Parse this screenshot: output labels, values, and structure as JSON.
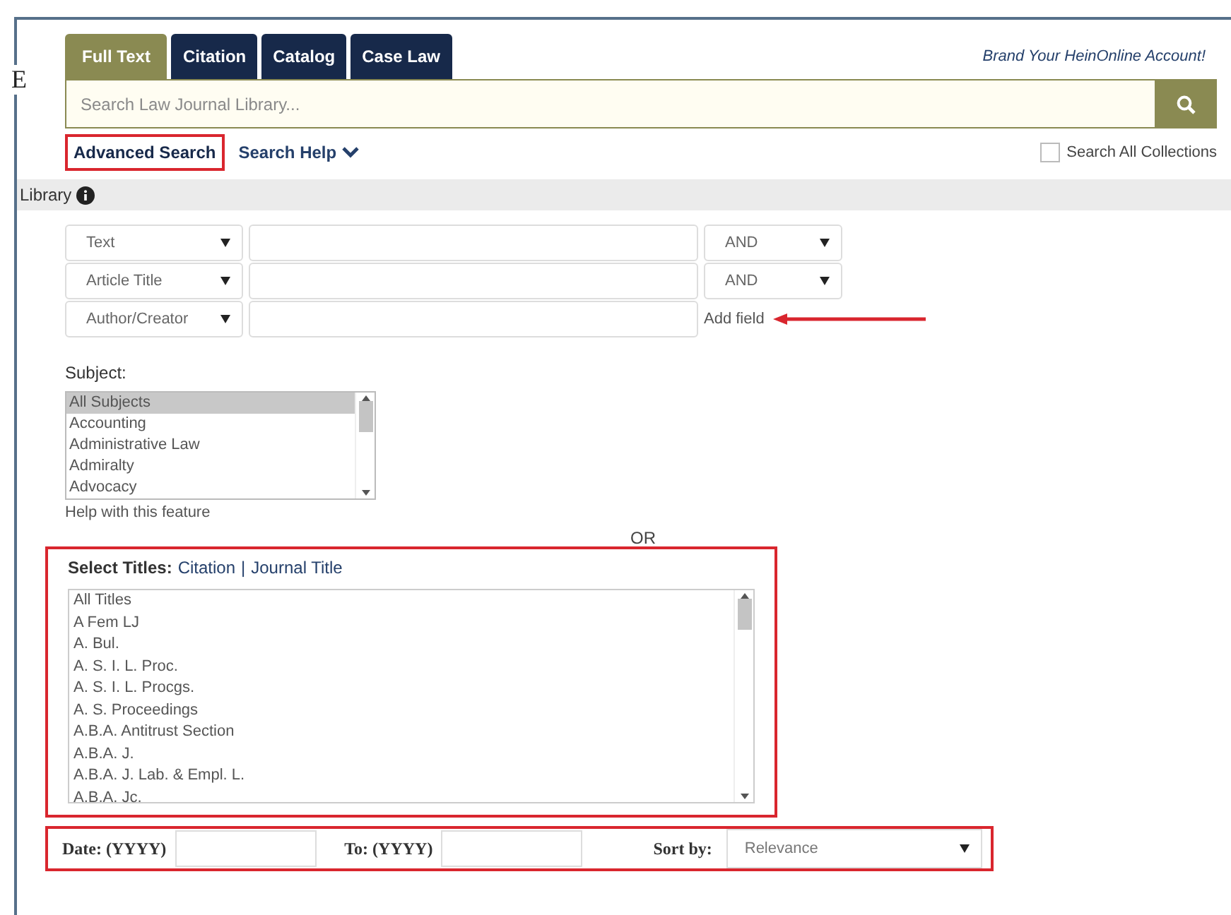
{
  "stray_glyph": "E",
  "tabs": [
    {
      "label": "Full Text",
      "selected": true
    },
    {
      "label": "Citation",
      "selected": false
    },
    {
      "label": "Catalog",
      "selected": false
    },
    {
      "label": "Case Law",
      "selected": false
    }
  ],
  "account_link": "Brand Your HeinOnline Account!",
  "search": {
    "placeholder": "Search Law Journal Library..."
  },
  "advanced_search": {
    "label": "Advanced Search",
    "highlighted": true
  },
  "search_help": "Search Help",
  "search_all": {
    "label": "Search All Collections",
    "checked": false
  },
  "library_label": "Library",
  "field_rows": [
    {
      "field": "Text",
      "value": "",
      "operator": "AND"
    },
    {
      "field": "Article Title",
      "value": "",
      "operator": "AND"
    },
    {
      "field": "Author/Creator",
      "value": ""
    }
  ],
  "add_field": "Add field",
  "subject": {
    "label": "Subject:",
    "items": [
      {
        "label": "All Subjects",
        "selected": true
      },
      {
        "label": "Accounting",
        "selected": false
      },
      {
        "label": "Administrative Law",
        "selected": false
      },
      {
        "label": "Admiralty",
        "selected": false
      },
      {
        "label": "Advocacy",
        "selected": false
      }
    ],
    "help": "Help with this feature"
  },
  "or_label": "OR",
  "titles": {
    "label": "Select Titles:",
    "links": [
      "Citation",
      "Journal Title"
    ],
    "separator": "|",
    "highlighted": true,
    "items": [
      "All Titles",
      "A Fem LJ",
      "A. Bul.",
      "A. S. I. L. Proc.",
      "A. S. I. L. Procgs.",
      "A. S. Proceedings",
      "A.B.A. Antitrust Section",
      "A.B.A. J.",
      "A.B.A. J. Lab. & Empl. L.",
      "A.B.A. Jc."
    ]
  },
  "date_row": {
    "highlighted": true,
    "from_label": "Date: (YYYY)",
    "to_label": "To: (YYYY)",
    "sort_label": "Sort by:",
    "sort_value": "Relevance"
  }
}
